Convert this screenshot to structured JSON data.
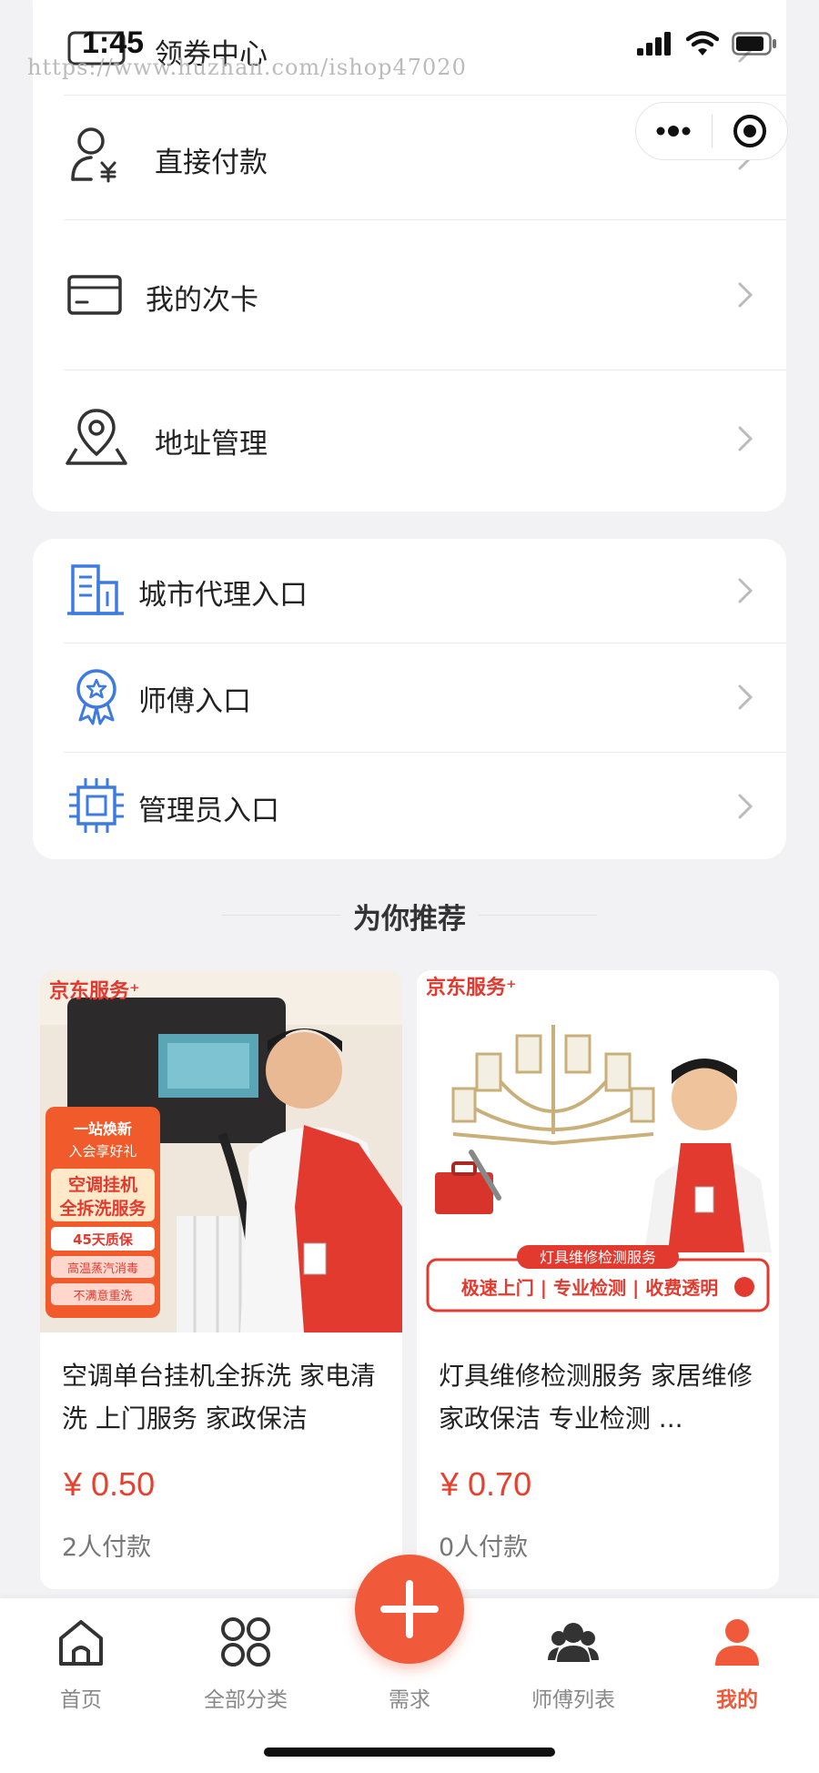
{
  "status_bar": {
    "time": "1:45",
    "watermark": "https://www.huzhan.com/ishop47020"
  },
  "menu_card_1": {
    "items": [
      {
        "label": "领券中心"
      },
      {
        "label": "直接付款"
      },
      {
        "label": "我的次卡"
      },
      {
        "label": "地址管理"
      }
    ]
  },
  "menu_card_2": {
    "items": [
      {
        "label": "城市代理入口"
      },
      {
        "label": "师傅入口"
      },
      {
        "label": "管理员入口"
      }
    ]
  },
  "recommend": {
    "title": "为你推荐",
    "products": [
      {
        "brand": "京东服务⁺",
        "promo_lines": [
          "一站焕新",
          "入会享好礼",
          "空调挂机",
          "全拆洗服务",
          "45天质保",
          "高温蒸汽消毒",
          "不满意重洗"
        ],
        "title": "空调单台挂机全拆洗 家电清洗 上门服务 家政保洁",
        "price": "¥ 0.50",
        "sold": "2人付款"
      },
      {
        "brand": "京东服务⁺",
        "banner_top": "灯具维修检测服务",
        "banner_main": "极速上门 | 专业检测 | 收费透明",
        "title": "灯具维修检测服务 家居维修 家政保洁 专业检测 ...",
        "price": "¥ 0.70",
        "sold": "0人付款"
      }
    ]
  },
  "tabbar": {
    "tabs": [
      {
        "label": "首页",
        "icon": "home-icon",
        "active": false
      },
      {
        "label": "全部分类",
        "icon": "grid-icon",
        "active": false
      },
      {
        "label": "需求",
        "icon": "plus-icon",
        "active": false
      },
      {
        "label": "师傅列表",
        "icon": "group-icon",
        "active": false
      },
      {
        "label": "我的",
        "icon": "user-icon",
        "active": true
      }
    ]
  },
  "colors": {
    "accent": "#f05a3a",
    "price": "#e8402f",
    "icon_blue": "#3d7be0"
  }
}
